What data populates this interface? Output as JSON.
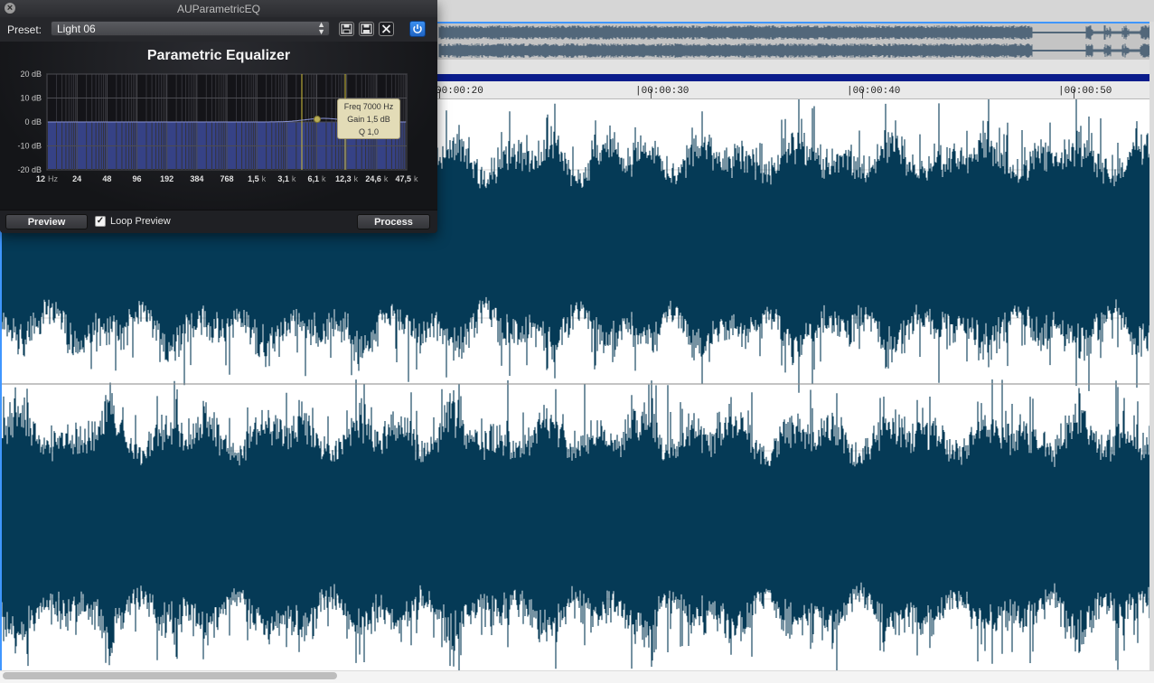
{
  "colors": {
    "waveform": "#053a56",
    "selection_border": "#3f96ff",
    "position_bar": "#0a1c8c",
    "eq_fill": "#3c4a9a",
    "marker_line": "#d2c03a",
    "power_button": "#2d7ee0"
  },
  "eq_window": {
    "title": "AUParametricEQ",
    "preset_label": "Preset:",
    "preset_value": "Light 06",
    "toolbar_icons": [
      "save-icon",
      "save-as-icon",
      "delete-icon",
      "power-icon"
    ],
    "heading": "Parametric Equalizer",
    "db_labels": [
      "20 dB",
      "10 dB",
      "0 dB",
      "-10 dB",
      "-20 dB"
    ],
    "freq_labels": [
      {
        "n": "12",
        "u": "Hz"
      },
      {
        "n": "24",
        "u": ""
      },
      {
        "n": "48",
        "u": ""
      },
      {
        "n": "96",
        "u": ""
      },
      {
        "n": "192",
        "u": ""
      },
      {
        "n": "384",
        "u": ""
      },
      {
        "n": "768",
        "u": ""
      },
      {
        "n": "1,5",
        "u": "k"
      },
      {
        "n": "3,1",
        "u": "k"
      },
      {
        "n": "6,1",
        "u": "k"
      },
      {
        "n": "12,3",
        "u": "k"
      },
      {
        "n": "24,6",
        "u": "k"
      },
      {
        "n": "47,5",
        "u": "k"
      }
    ],
    "tooltip": {
      "freq": "Freq  7000 Hz",
      "gain": "Gain  1,5 dB",
      "q": "Q  1,0"
    },
    "band": {
      "freq_hz": 7000,
      "gain_db": 1.5,
      "q": 1.0
    },
    "preview_button": "Preview",
    "loop_preview_label": "Loop Preview",
    "loop_preview_checked": true,
    "process_button": "Process"
  },
  "timeline": {
    "labels": [
      "00:00:20",
      "|00:00:30",
      "|00:00:40",
      "|00:00:50"
    ]
  }
}
